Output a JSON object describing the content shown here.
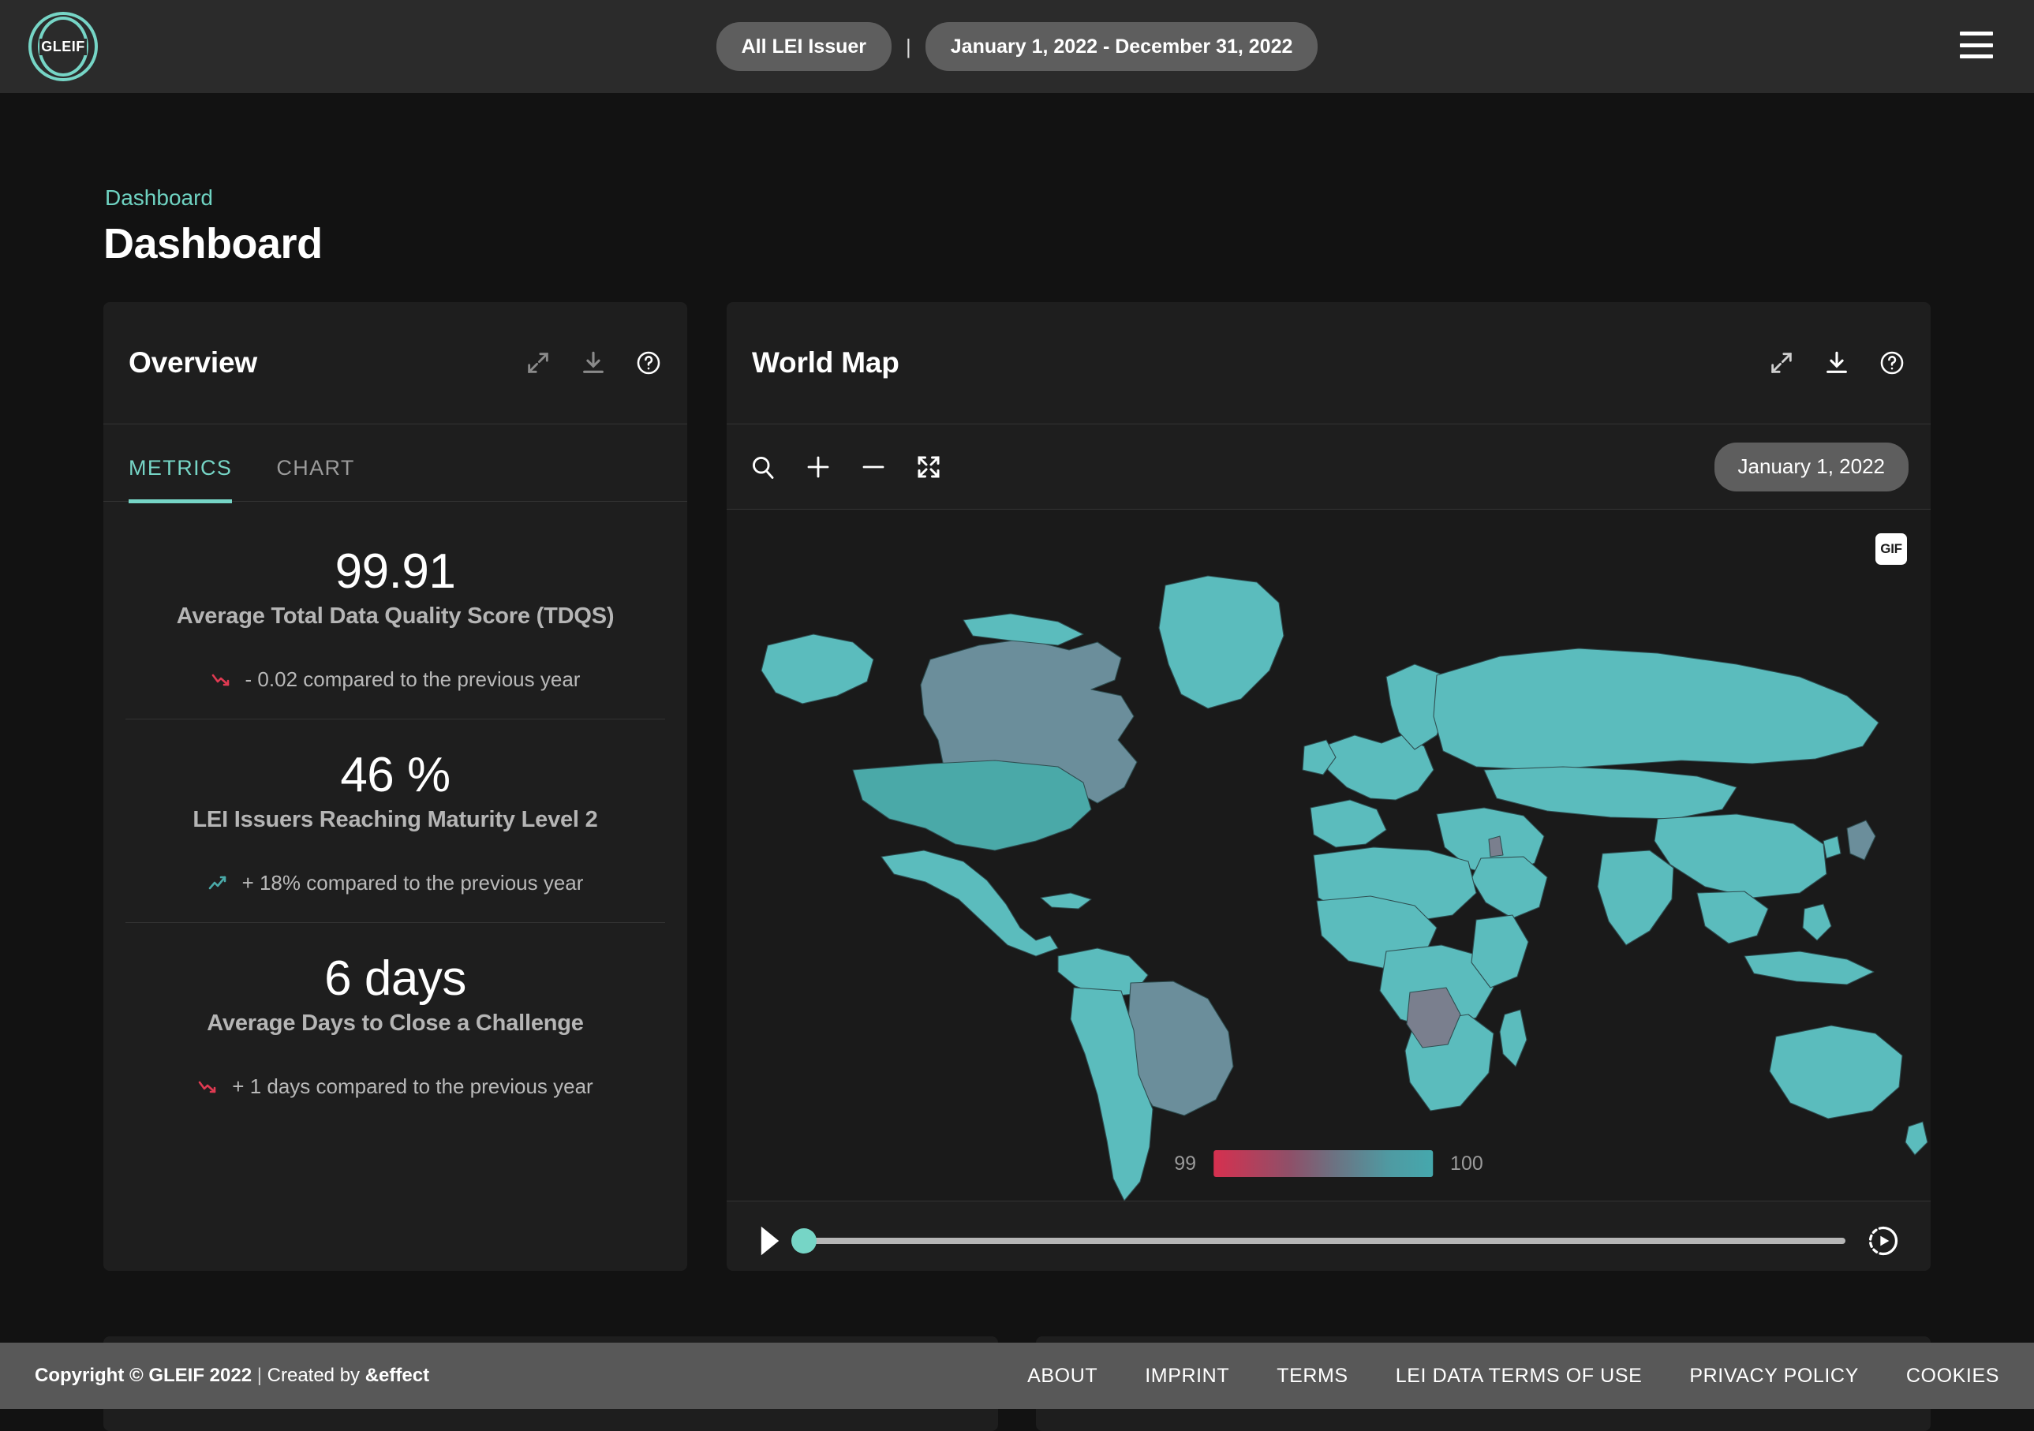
{
  "topbar": {
    "logo_text": "GLEIF",
    "issuer_filter": "All LEI Issuer",
    "separator": "|",
    "date_range": "January 1, 2022 - December 31, 2022",
    "menu_icon": "hamburger-menu-icon"
  },
  "header": {
    "breadcrumb": "Dashboard",
    "title": "Dashboard"
  },
  "overview": {
    "title": "Overview",
    "icons": [
      "expand-icon",
      "download-icon",
      "help-icon"
    ],
    "tabs": [
      {
        "label": "METRICS",
        "active": true
      },
      {
        "label": "CHART",
        "active": false
      }
    ],
    "metrics": [
      {
        "value": "99.91",
        "label": "Average Total Data Quality Score (TDQS)",
        "delta": "- 0.02 compared to the previous year",
        "trend": "down",
        "trend_color": "#e03a52"
      },
      {
        "value": "46 %",
        "label": "LEI Issuers Reaching Maturity Level 2",
        "delta": "+ 18% compared to the previous year",
        "trend": "up",
        "trend_color": "#4aa9a8"
      },
      {
        "value": "6 days",
        "label": "Average Days to Close a Challenge",
        "delta": "+ 1 days compared to the previous year",
        "trend": "down",
        "trend_color": "#e03a52"
      }
    ]
  },
  "world_map": {
    "title": "World Map",
    "icons": [
      "expand-icon",
      "download-icon",
      "help-icon"
    ],
    "toolbar_icons": [
      "search-icon",
      "zoom-in-icon",
      "zoom-out-icon",
      "fullscreen-icon"
    ],
    "date_pill": "January 1, 2022",
    "gif_badge": "GIF",
    "legend": {
      "min": "99",
      "max": "100",
      "gradient_from": "#d6304f",
      "gradient_to": "#45a8ad"
    },
    "player": {
      "play_icon": "play-icon",
      "speed_icon": "playback-speed-icon",
      "slider_position_percent": 0
    },
    "map_colors": {
      "land_high": "#5bbcbd",
      "land_mid": "#6b8e9b",
      "land_low": "#7a7f8e",
      "ocean": "#1a1a1a",
      "border": "#2f4f52"
    }
  },
  "footer": {
    "copyright_bold": "Copyright © GLEIF 2022",
    "copyright_sep": " | ",
    "copyright_mid": "Created by ",
    "copyright_brand": "&effect",
    "links": [
      "ABOUT",
      "IMPRINT",
      "TERMS",
      "LEI DATA TERMS OF USE",
      "PRIVACY POLICY",
      "COOKIES"
    ]
  }
}
